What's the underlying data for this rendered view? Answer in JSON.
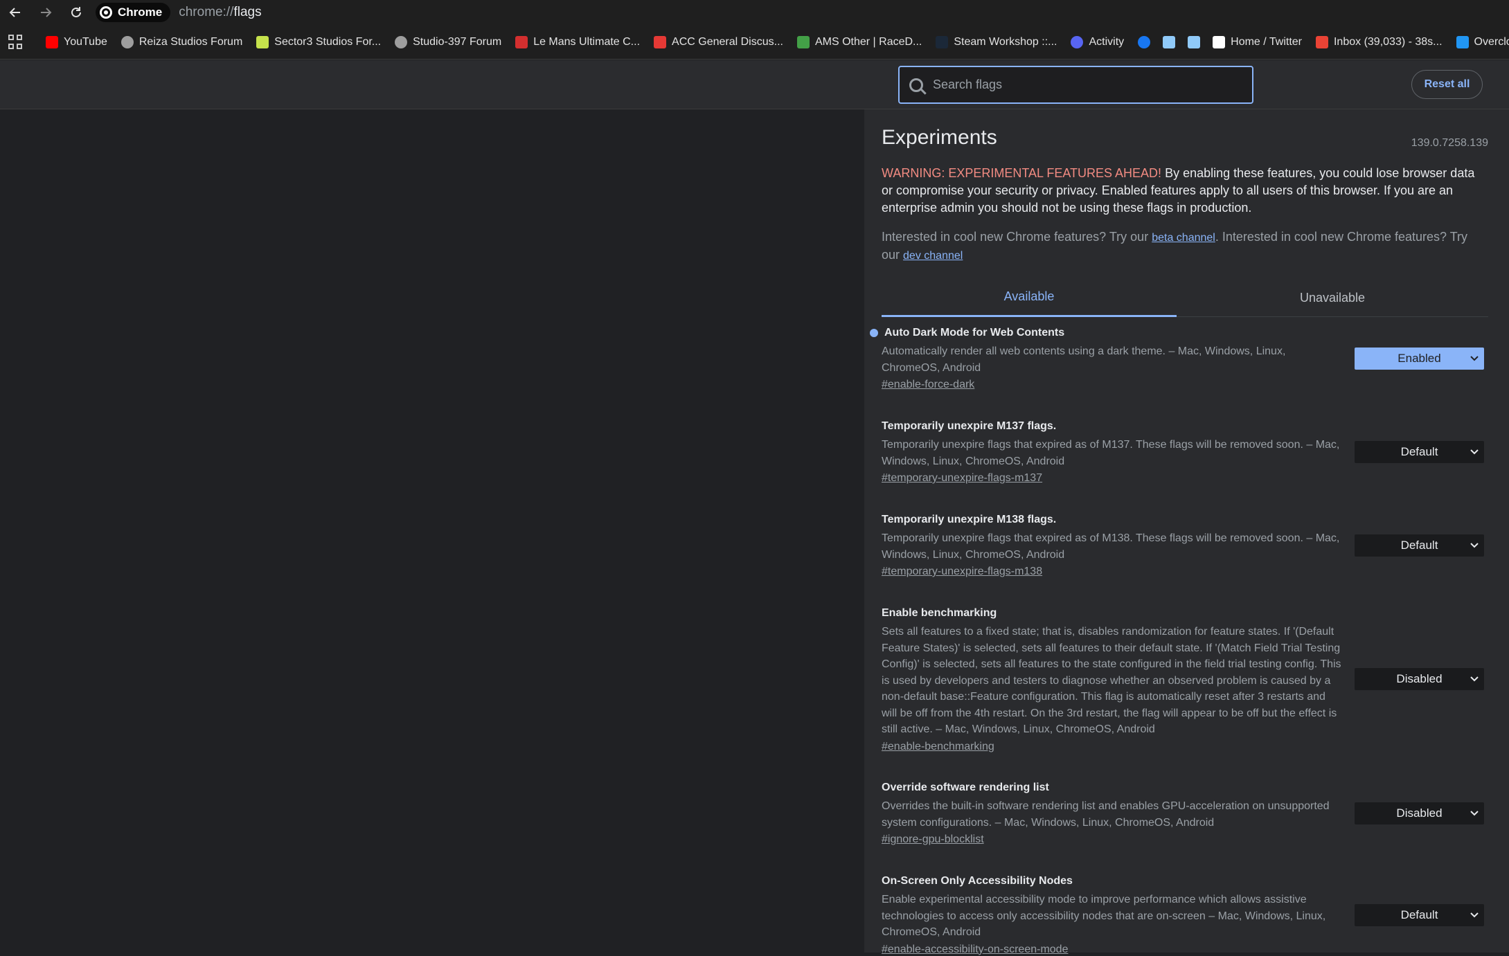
{
  "browser": {
    "chip_label": "Chrome",
    "url_prefix": "chrome://",
    "url_path": "flags"
  },
  "bookmarks": [
    {
      "label": "YouTube",
      "color": "#ff0000"
    },
    {
      "label": "Reiza Studios Forum",
      "color": "#9e9e9e"
    },
    {
      "label": "Sector3 Studios For...",
      "color": "#c6e24c"
    },
    {
      "label": "Studio-397 Forum",
      "color": "#9e9e9e"
    },
    {
      "label": "Le Mans Ultimate C...",
      "color": "#d32f2f"
    },
    {
      "label": "ACC General Discus...",
      "color": "#e53935"
    },
    {
      "label": "AMS Other | RaceD...",
      "color": "#43a047"
    },
    {
      "label": "Steam Workshop ::...",
      "color": "#1b2838"
    },
    {
      "label": "Activity",
      "color": "#5865f2"
    },
    {
      "label": "",
      "color": "#1877f2"
    },
    {
      "label": "",
      "color": "#90caf9"
    },
    {
      "label": "",
      "color": "#90caf9"
    },
    {
      "label": "Home / Twitter",
      "color": "#ffffff"
    },
    {
      "label": "Inbox (39,033) - 38s...",
      "color": "#ea4335"
    },
    {
      "label": "Overclocki",
      "color": "#2196f3"
    }
  ],
  "toolbar": {
    "search_placeholder": "Search flags",
    "reset_label": "Reset all"
  },
  "header": {
    "title": "Experiments",
    "version": "139.0.7258.139",
    "warning_label": "WARNING: EXPERIMENTAL FEATURES AHEAD!",
    "warning_text": " By enabling these features, you could lose browser data or compromise your security or privacy. Enabled features apply to all users of this browser. If you are an enterprise admin you should not be using these flags in production.",
    "interested_1": "Interested in cool new Chrome features? Try our ",
    "beta_link": "beta channel",
    "interested_2": ". Interested in cool new Chrome features? Try our ",
    "dev_link": "dev channel"
  },
  "tabs": {
    "available": "Available",
    "unavailable": "Unavailable"
  },
  "experiments": [
    {
      "title": "Auto Dark Mode for Web Contents",
      "desc": "Automatically render all web contents using a dark theme. – Mac, Windows, Linux, ChromeOS, Android",
      "link": "#enable-force-dark",
      "value": "Enabled",
      "modified": true
    },
    {
      "title": "Temporarily unexpire M137 flags.",
      "desc": "Temporarily unexpire flags that expired as of M137. These flags will be removed soon. – Mac, Windows, Linux, ChromeOS, Android",
      "link": "#temporary-unexpire-flags-m137",
      "value": "Default"
    },
    {
      "title": "Temporarily unexpire M138 flags.",
      "desc": "Temporarily unexpire flags that expired as of M138. These flags will be removed soon. – Mac, Windows, Linux, ChromeOS, Android",
      "link": "#temporary-unexpire-flags-m138",
      "value": "Default"
    },
    {
      "title": "Enable benchmarking",
      "desc": "Sets all features to a fixed state; that is, disables randomization for feature states. If '(Default Feature States)' is selected, sets all features to their default state. If '(Match Field Trial Testing Config)' is selected, sets all features to the state configured in the field trial testing config. This is used by developers and testers to diagnose whether an observed problem is caused by a non-default base::Feature configuration. This flag is automatically reset after 3 restarts and will be off from the 4th restart. On the 3rd restart, the flag will appear to be off but the effect is still active. – Mac, Windows, Linux, ChromeOS, Android",
      "link": "#enable-benchmarking",
      "value": "Disabled"
    },
    {
      "title": "Override software rendering list",
      "desc": "Overrides the built-in software rendering list and enables GPU-acceleration on unsupported system configurations. – Mac, Windows, Linux, ChromeOS, Android",
      "link": "#ignore-gpu-blocklist",
      "value": "Disabled"
    },
    {
      "title": "On-Screen Only Accessibility Nodes",
      "desc": "Enable experimental accessibility mode to improve performance which allows assistive technologies to access only accessibility nodes that are on-screen – Mac, Windows, Linux, ChromeOS, Android",
      "link": "#enable-accessibility-on-screen-mode",
      "value": "Default"
    }
  ]
}
